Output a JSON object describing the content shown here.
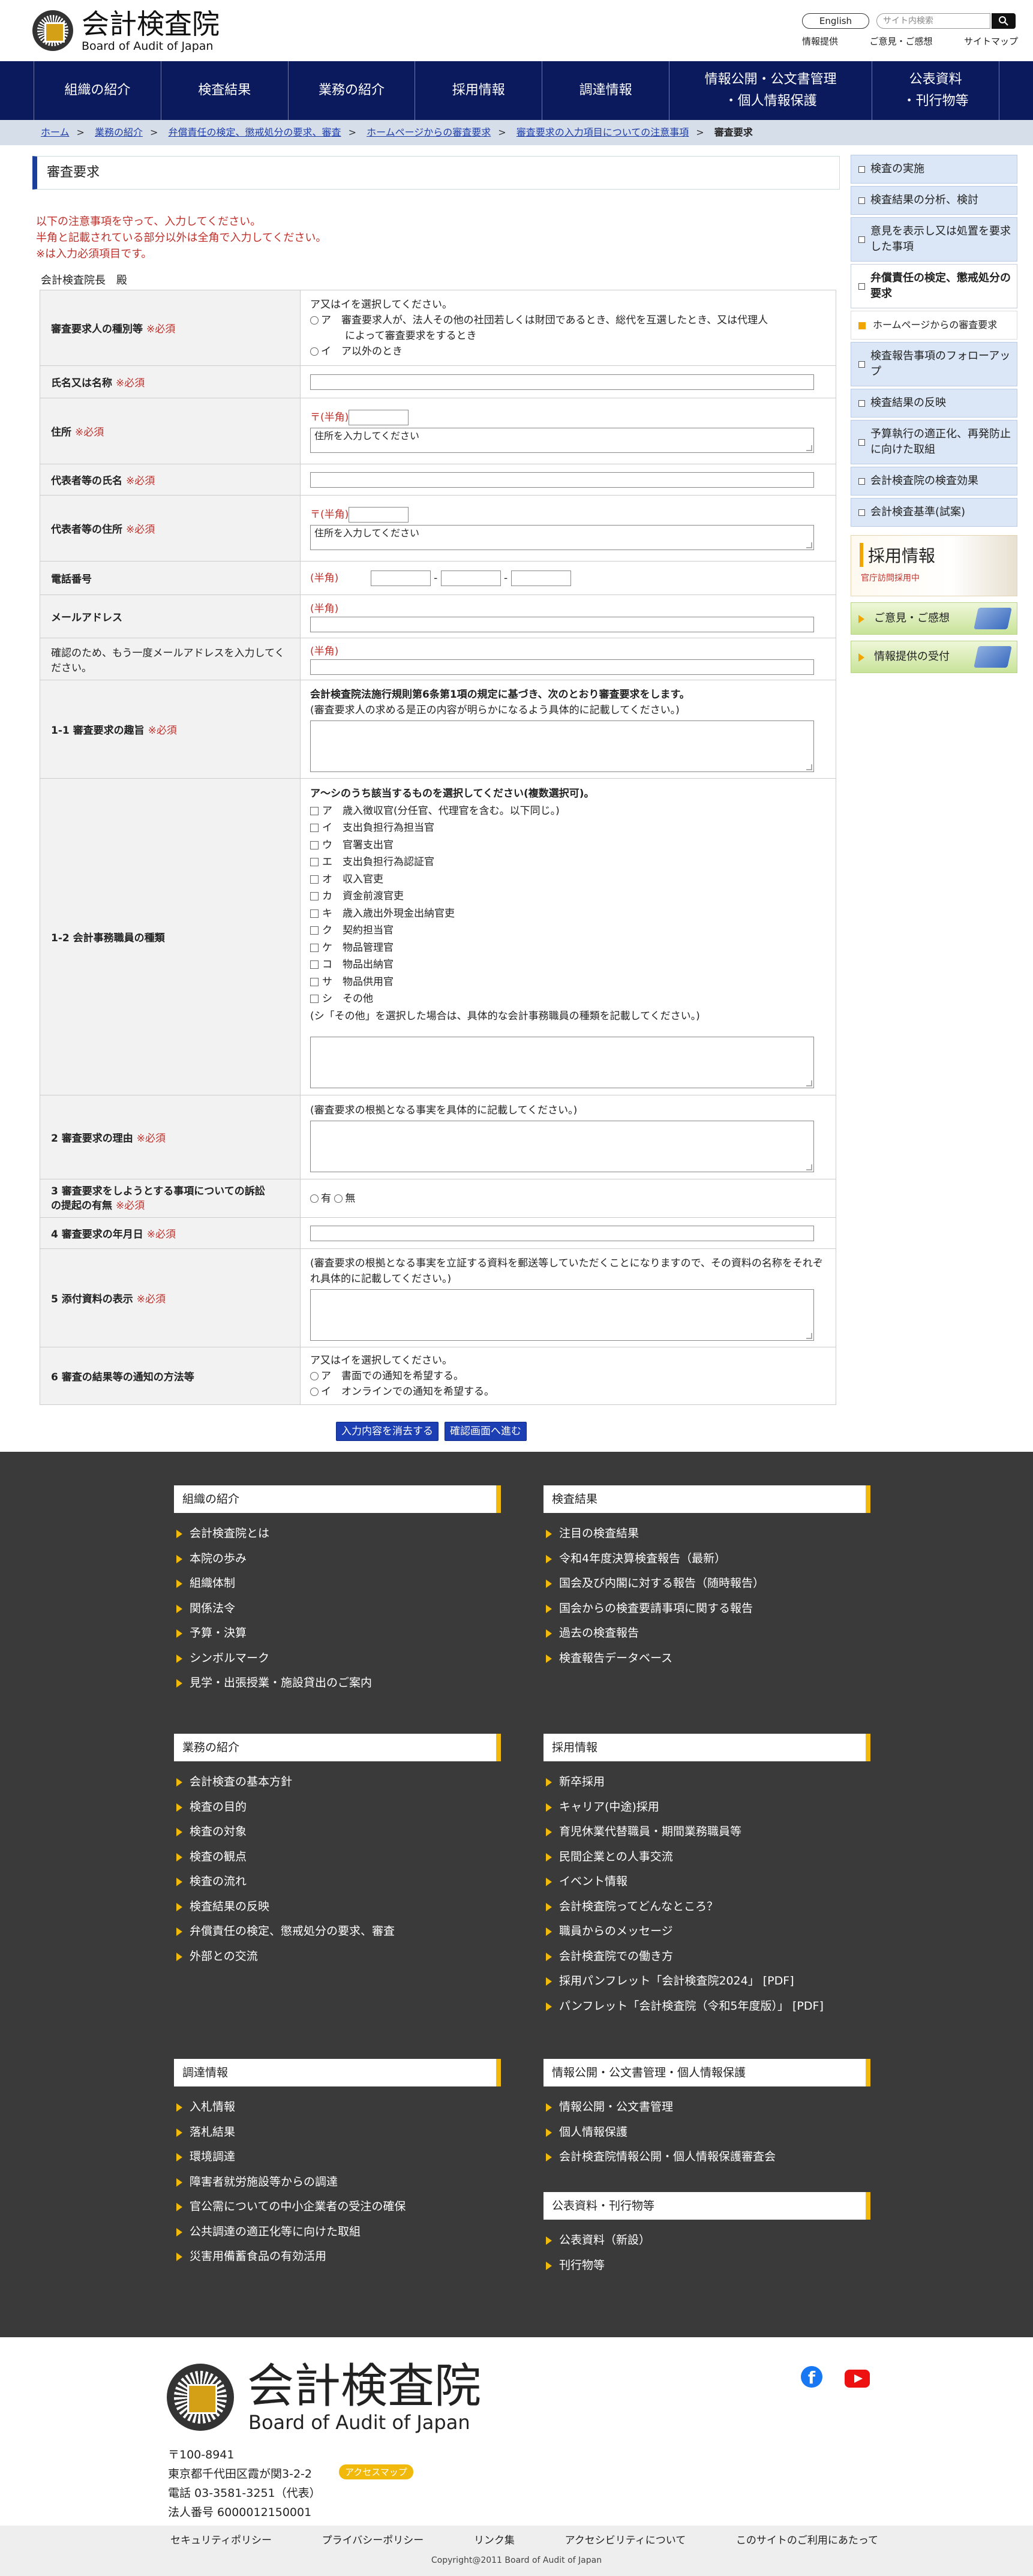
{
  "header": {
    "logo_ja": "会計検査院",
    "logo_en": "Board of Audit of Japan",
    "english": "English",
    "search_placeholder": "サイト内検索",
    "links": [
      "情報提供",
      "ご意見・ご感想",
      "サイトマップ"
    ]
  },
  "nav": [
    "組織の紹介",
    "検査結果",
    "業務の紹介",
    "採用情報",
    "調達情報",
    "情報公開・公文書管理\n・個人情報保護",
    "公表資料\n・刊行物等"
  ],
  "breadcrumb": [
    "ホーム",
    "業務の紹介",
    "弁償責任の検定、懲戒処分の要求、審査",
    "ホームページからの審査要求",
    "審査要求の入力項目についての注意事項",
    "審査要求"
  ],
  "page_title": "審査要求",
  "notes": [
    "以下の注意事項を守って、入力してください。",
    "半角と記載されている部分以外は全角で入力してください。",
    "※は入力必須項目です。"
  ],
  "to_label": "会計検査院長　殿",
  "req_mark": "※必須",
  "form": {
    "kind_label": "審査要求人の種別等",
    "kind_intro": "ア又はイを選択してください。",
    "kind_a1": "ア　審査要求人が、法人その他の社団若しくは財団であるとき、総代を互選したとき、又は代理人",
    "kind_a2": "によって審査要求をするとき",
    "kind_b": "イ　ア以外のとき",
    "name_label": "氏名又は名称",
    "addr_label": "住所",
    "zip": "〒(半角)",
    "addr_ph": "住所を入力してください",
    "rep_name_label": "代表者等の氏名",
    "rep_addr_label": "代表者等の住所",
    "tel_label": "電話番号",
    "half": "(半角)",
    "dash": "-",
    "mail_label": "メールアドレス",
    "mail2_label": "確認のため、もう一度メールアドレスを入力してください。",
    "purpose_label": "1-1 審査要求の趣旨",
    "purpose_t1": "会計検査院法施行規則第6条第1項の規定に基づき、次のとおり審査要求をします。",
    "purpose_t2": "(審査要求人の求める是正の内容が明らかになるよう具体的に記載してください。)",
    "officer_label": "1-2 会計事務職員の種類",
    "officer_intro": "ア～シのうち該当するものを選択してください(複数選択可)。",
    "officers": [
      "ア　歳入徴収官(分任官、代理官を含む。以下同じ。)",
      "イ　支出負担行為担当官",
      "ウ　官署支出官",
      "エ　支出負担行為認証官",
      "オ　収入官吏",
      "カ　資金前渡官吏",
      "キ　歳入歳出外現金出納官吏",
      "ク　契約担当官",
      "ケ　物品管理官",
      "コ　物品出納官",
      "サ　物品供用官",
      "シ　その他"
    ],
    "officer_note": "(シ「その他」を選択した場合は、具体的な会計事務職員の種類を記載してください。)",
    "reason_label": "2 審査要求の理由",
    "reason_note": "(審査要求の根拠となる事実を具体的に記載してください。)",
    "suit_label1": "3 審査要求をしようとする事項についての訴訟",
    "suit_label2": "の提起の有無",
    "suit_yes": "有",
    "suit_no": "無",
    "date_label": "4 審査要求の年月日",
    "attach_label": "5 添付資料の表示",
    "attach_note": "(審査要求の根拠となる事実を立証する資料を郵送等していただくことになりますので、その資料の名称をそれぞれ具体的に記載してください。)",
    "notify_label": "6 審査の結果等の通知の方法等",
    "notify_intro": "ア又はイを選択してください。",
    "notify_a": "ア　書面での通知を希望する。",
    "notify_b": "イ　オンラインでの通知を希望する。"
  },
  "buttons": {
    "clear": "入力内容を消去する",
    "confirm": "確認画面へ進む"
  },
  "side": [
    "検査の実施",
    "検査結果の分析、検討",
    "意見を表示し又は処置を要求した事項",
    "弁償責任の検定、懲戒処分の要求",
    "ホームページからの審査要求",
    "検査報告事項のフォローアップ",
    "検査結果の反映",
    "予算執行の適正化、再発防止に向けた取組",
    "会計検査院の検査効果",
    "会計検査基準(試案)"
  ],
  "banner": {
    "title": "採用情報",
    "sub": "官庁訪問採用中"
  },
  "side_buttons": [
    "ご意見・ご感想",
    "情報提供の受付"
  ],
  "footer": [
    {
      "head": "組織の紹介",
      "items": [
        "会計検査院とは",
        "本院の歩み",
        "組織体制",
        "関係法令",
        "予算・決算",
        "シンボルマーク",
        "見学・出張授業・施設貸出のご案内"
      ]
    },
    {
      "head": "検査結果",
      "items": [
        "注目の検査結果",
        "令和4年度決算検査報告（最新）",
        "国会及び内閣に対する報告（随時報告）",
        "国会からの検査要請事項に関する報告",
        "過去の検査報告",
        "検査報告データベース"
      ]
    },
    {
      "head": "業務の紹介",
      "items": [
        "会計検査の基本方針",
        "検査の目的",
        "検査の対象",
        "検査の観点",
        "検査の流れ",
        "検査結果の反映",
        "弁償責任の検定、懲戒処分の要求、審査",
        "外部との交流"
      ]
    },
    {
      "head": "採用情報",
      "items": [
        "新卒採用",
        "キャリア(中途)採用",
        "育児休業代替職員・期間業務職員等",
        "民間企業との人事交流",
        "イベント情報",
        "会計検査院ってどんなところ？",
        "職員からのメッセージ",
        "会計検査院での働き方",
        "採用パンフレット「会計検査院2024」 [PDF]",
        "パンフレット「会計検査院（令和5年度版）」 [PDF]"
      ]
    },
    {
      "head": "調達情報",
      "items": [
        "入札情報",
        "落札結果",
        "環境調達",
        "障害者就労施設等からの調達",
        "官公需についての中小企業者の受注の確保",
        "公共調達の適正化等に向けた取組",
        "災害用備蓄食品の有効活用"
      ]
    },
    {
      "head": "情報公開・公文書管理・個人情報保護",
      "items": [
        "情報公開・公文書管理",
        "個人情報保護",
        "会計検査院情報公開・個人情報保護審査会"
      ]
    },
    {
      "head": "公表資料・刊行物等",
      "items": [
        "公表資料（新設）",
        "刊行物等"
      ]
    }
  ],
  "address": {
    "zip": "〒100-8941",
    "addr": "東京都千代田区霞が関3-2-2",
    "tel": "電話 03-3581-3251（代表）",
    "corp": "法人番号 6000012150001",
    "access": "アクセスマップ"
  },
  "legal": [
    "セキュリティポリシー",
    "プライバシーポリシー",
    "リンク集",
    "アクセシビリティについて",
    "このサイトのご利用にあたって"
  ],
  "copyright": "Copyright@2011 Board of Audit of Japan"
}
